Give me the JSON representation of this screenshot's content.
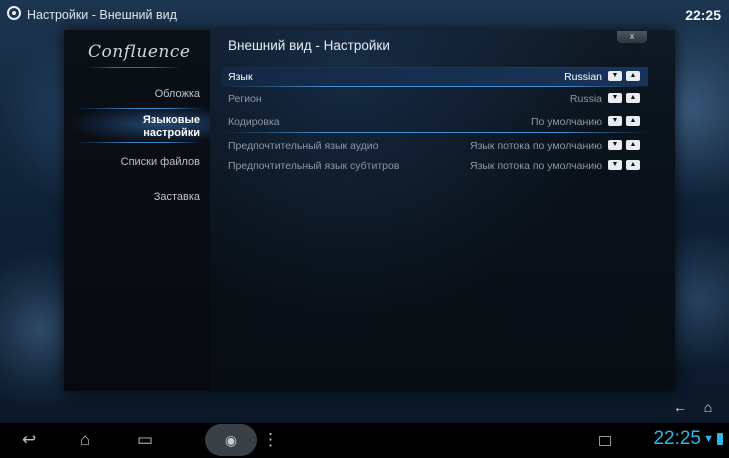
{
  "topbar": {
    "breadcrumb": "Настройки  - Внешний вид",
    "clock": "22:25"
  },
  "sidebar": {
    "brand": "Confluence",
    "items": [
      {
        "label": "Обложка"
      },
      {
        "label": "Языковые настройки",
        "line1": "Языковые",
        "line2": "настройки"
      },
      {
        "label": "Списки файлов"
      },
      {
        "label": "Заставка"
      }
    ],
    "selected_index": 1
  },
  "dialog": {
    "title": "Внешний вид - Настройки",
    "close_label": "x"
  },
  "settings": [
    {
      "label": "Язык",
      "value": "Russian"
    },
    {
      "label": "Регион",
      "value": "Russia"
    },
    {
      "label": "Кодировка",
      "value": "По умолчанию"
    },
    {
      "label": "Предпочтительный язык аудио",
      "value": "Язык потока по умолчанию"
    },
    {
      "label": "Предпочтительный язык субтитров",
      "value": "Язык потока по умолчанию"
    }
  ],
  "spin_down_symbol": "▼",
  "spin_up_symbol": "▲",
  "kodi_buttons": {
    "back_icon": "back-arrow-icon",
    "home_icon": "home-icon"
  },
  "android_nav": {
    "clock": "22:25",
    "icons": [
      "back-icon",
      "home-icon",
      "recent-apps-icon",
      "camera-icon",
      "menu-icon",
      "gallery-icon",
      "wifi-icon",
      "battery-icon"
    ]
  },
  "colors": {
    "accent": "#2fb6e8",
    "focus_line": "#4a90d6"
  }
}
